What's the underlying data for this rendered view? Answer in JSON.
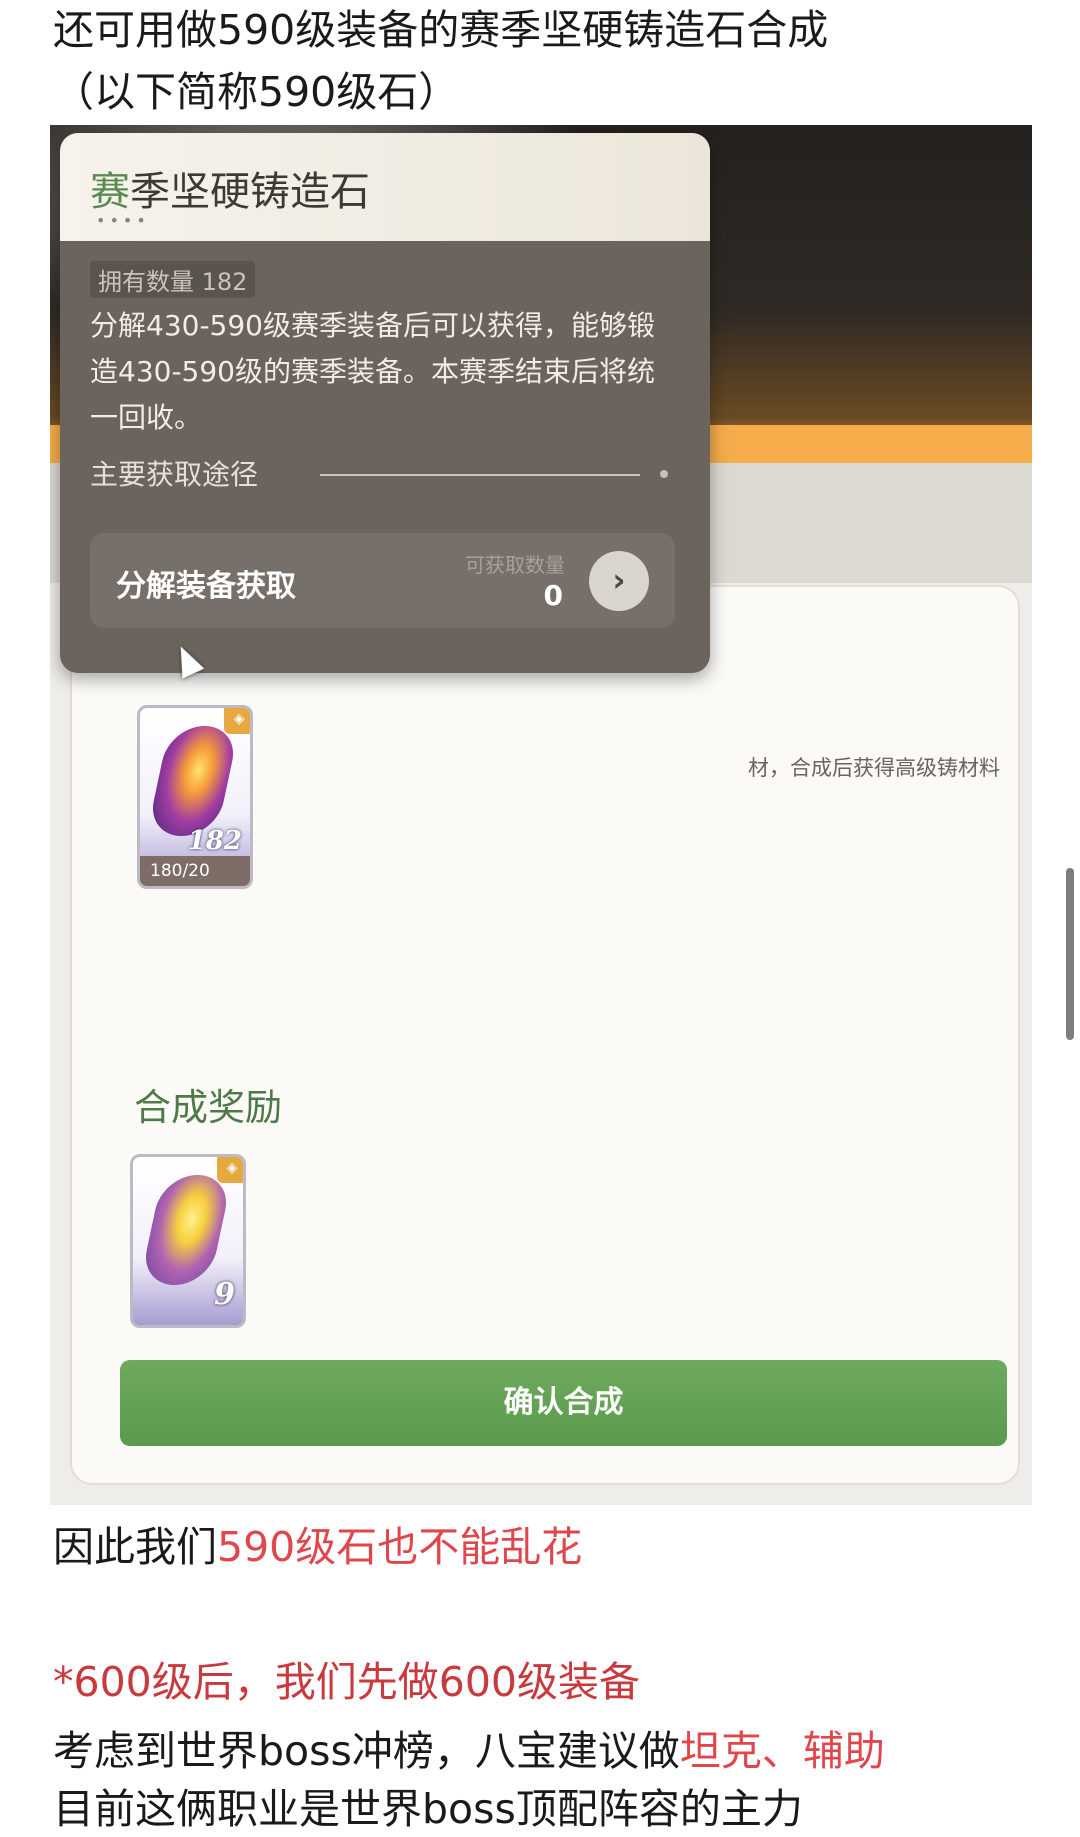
{
  "article": {
    "line1": "还可用做590级装备的赛季坚硬铸造石合成",
    "line2": "（以下简称590级石）",
    "line3_a": "因此我们",
    "line3_b": "590级石也不能乱花",
    "line4": "*600级后，我们先做600级装备",
    "line5_a": "考虑到世界boss冲榜，八宝建议做",
    "line5_b": "坦克、辅助",
    "line6": "目前这俩职业是世界boss顶配阵容的主力"
  },
  "tooltip": {
    "title_first": "赛",
    "title_rest": "季坚硬铸造石",
    "dots": "••••",
    "owned": "拥有数量 182",
    "description": "分解430-590级赛季装备后可以获得，能够锻造430-590级的赛季装备。本赛季结束后将统一回收。",
    "route_label": "主要获取途径",
    "source": {
      "label": "分解装备获取",
      "available_label": "可获取数量",
      "available_value": "0",
      "go_icon": "chevron-right-icon"
    }
  },
  "synthesis": {
    "desc": "材，合成后获得高级铸材料",
    "material": {
      "count": "182",
      "progress": "180/20"
    },
    "reward_title": "合成奖励",
    "reward": {
      "count": "9"
    },
    "confirm_label": "确认合成"
  },
  "colors": {
    "highlight_red": "#e0474c",
    "confirm_green": "#5a9a4d",
    "tooltip_bg": "#6b645d"
  }
}
